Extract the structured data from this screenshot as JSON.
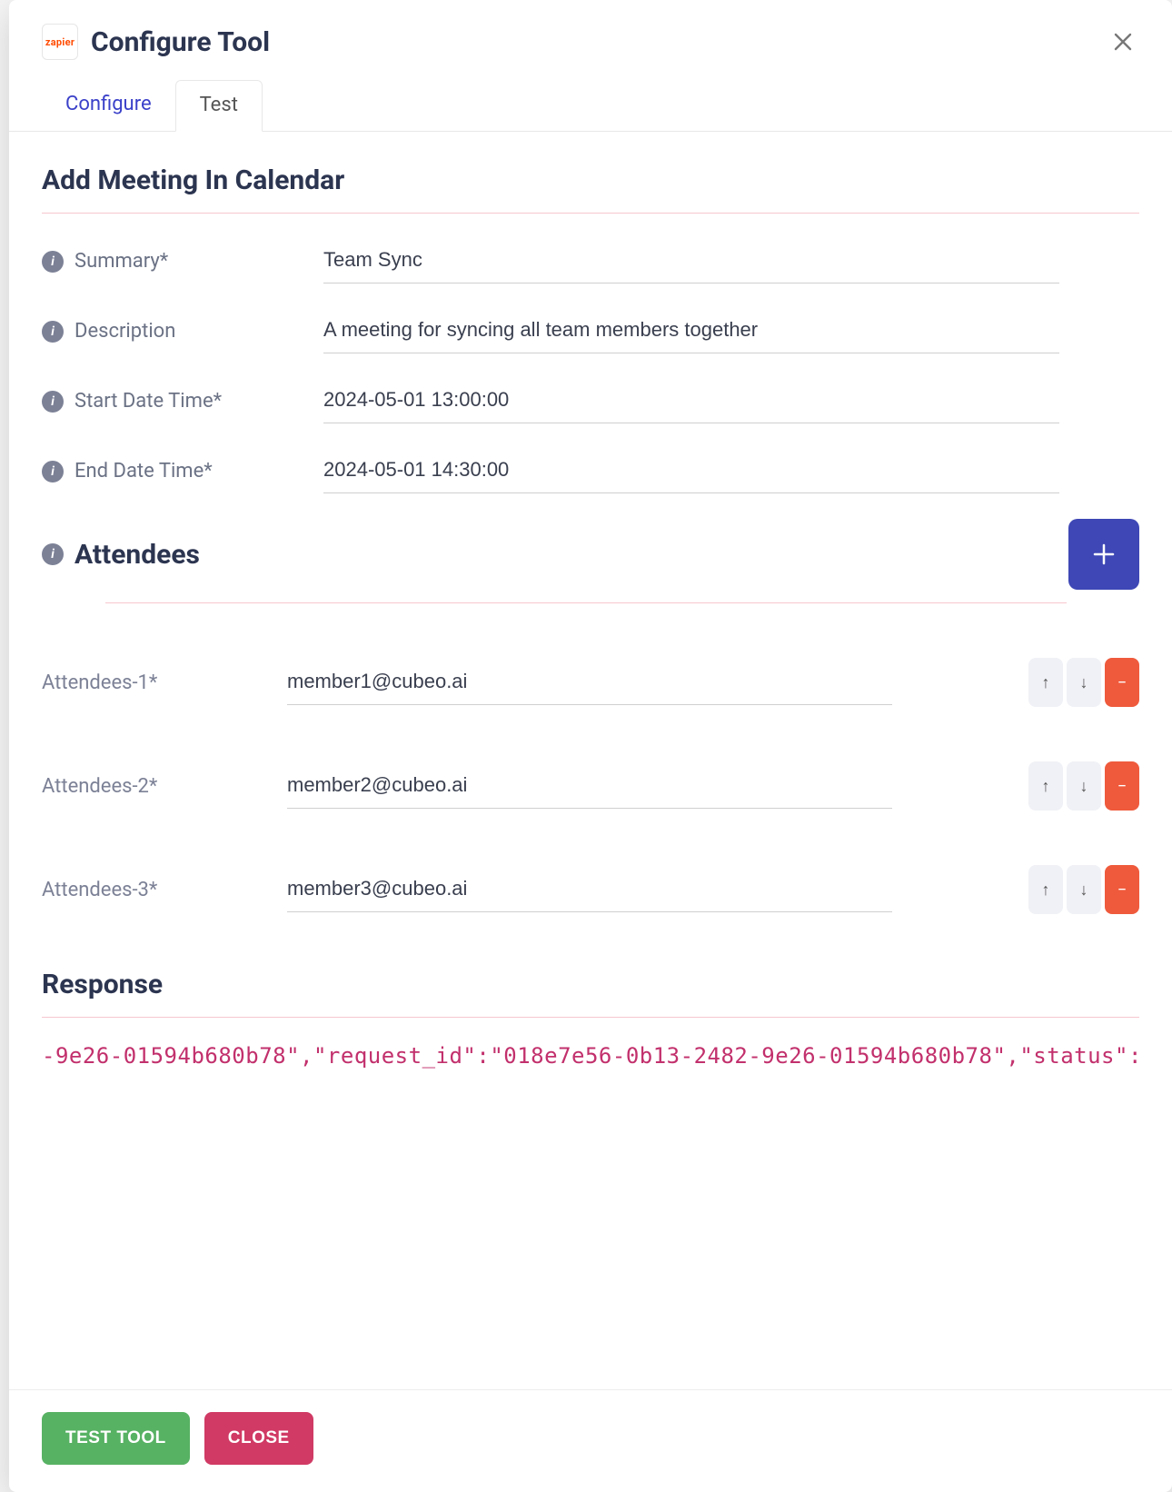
{
  "header": {
    "logo_text": "zapier",
    "title": "Configure Tool"
  },
  "tabs": {
    "configure": "Configure",
    "test": "Test"
  },
  "section": {
    "title": "Add Meeting In Calendar"
  },
  "fields": {
    "summary": {
      "label": "Summary*",
      "value": "Team Sync"
    },
    "description": {
      "label": "Description",
      "value": "A meeting for syncing all team members together"
    },
    "start": {
      "label": "Start Date Time*",
      "value": "2024-05-01 13:00:00"
    },
    "end": {
      "label": "End Date Time*",
      "value": "2024-05-01 14:30:00"
    }
  },
  "attendees": {
    "title": "Attendees",
    "items": [
      {
        "label": "Attendees-1*",
        "value": "member1@cubeo.ai"
      },
      {
        "label": "Attendees-2*",
        "value": "member2@cubeo.ai"
      },
      {
        "label": "Attendees-3*",
        "value": "member3@cubeo.ai"
      }
    ]
  },
  "response": {
    "title": "Response",
    "body": "-9e26-01594b680b78\",\"request_id\":\"018e7e56-0b13-2482-9e26-01594b680b78\",\"status\":\"success\"}"
  },
  "footer": {
    "test_tool": "TEST TOOL",
    "close": "CLOSE"
  },
  "icons": {
    "info": "i",
    "plus": "+",
    "up": "↑",
    "down": "↓",
    "minus": "−",
    "close": "✕"
  }
}
